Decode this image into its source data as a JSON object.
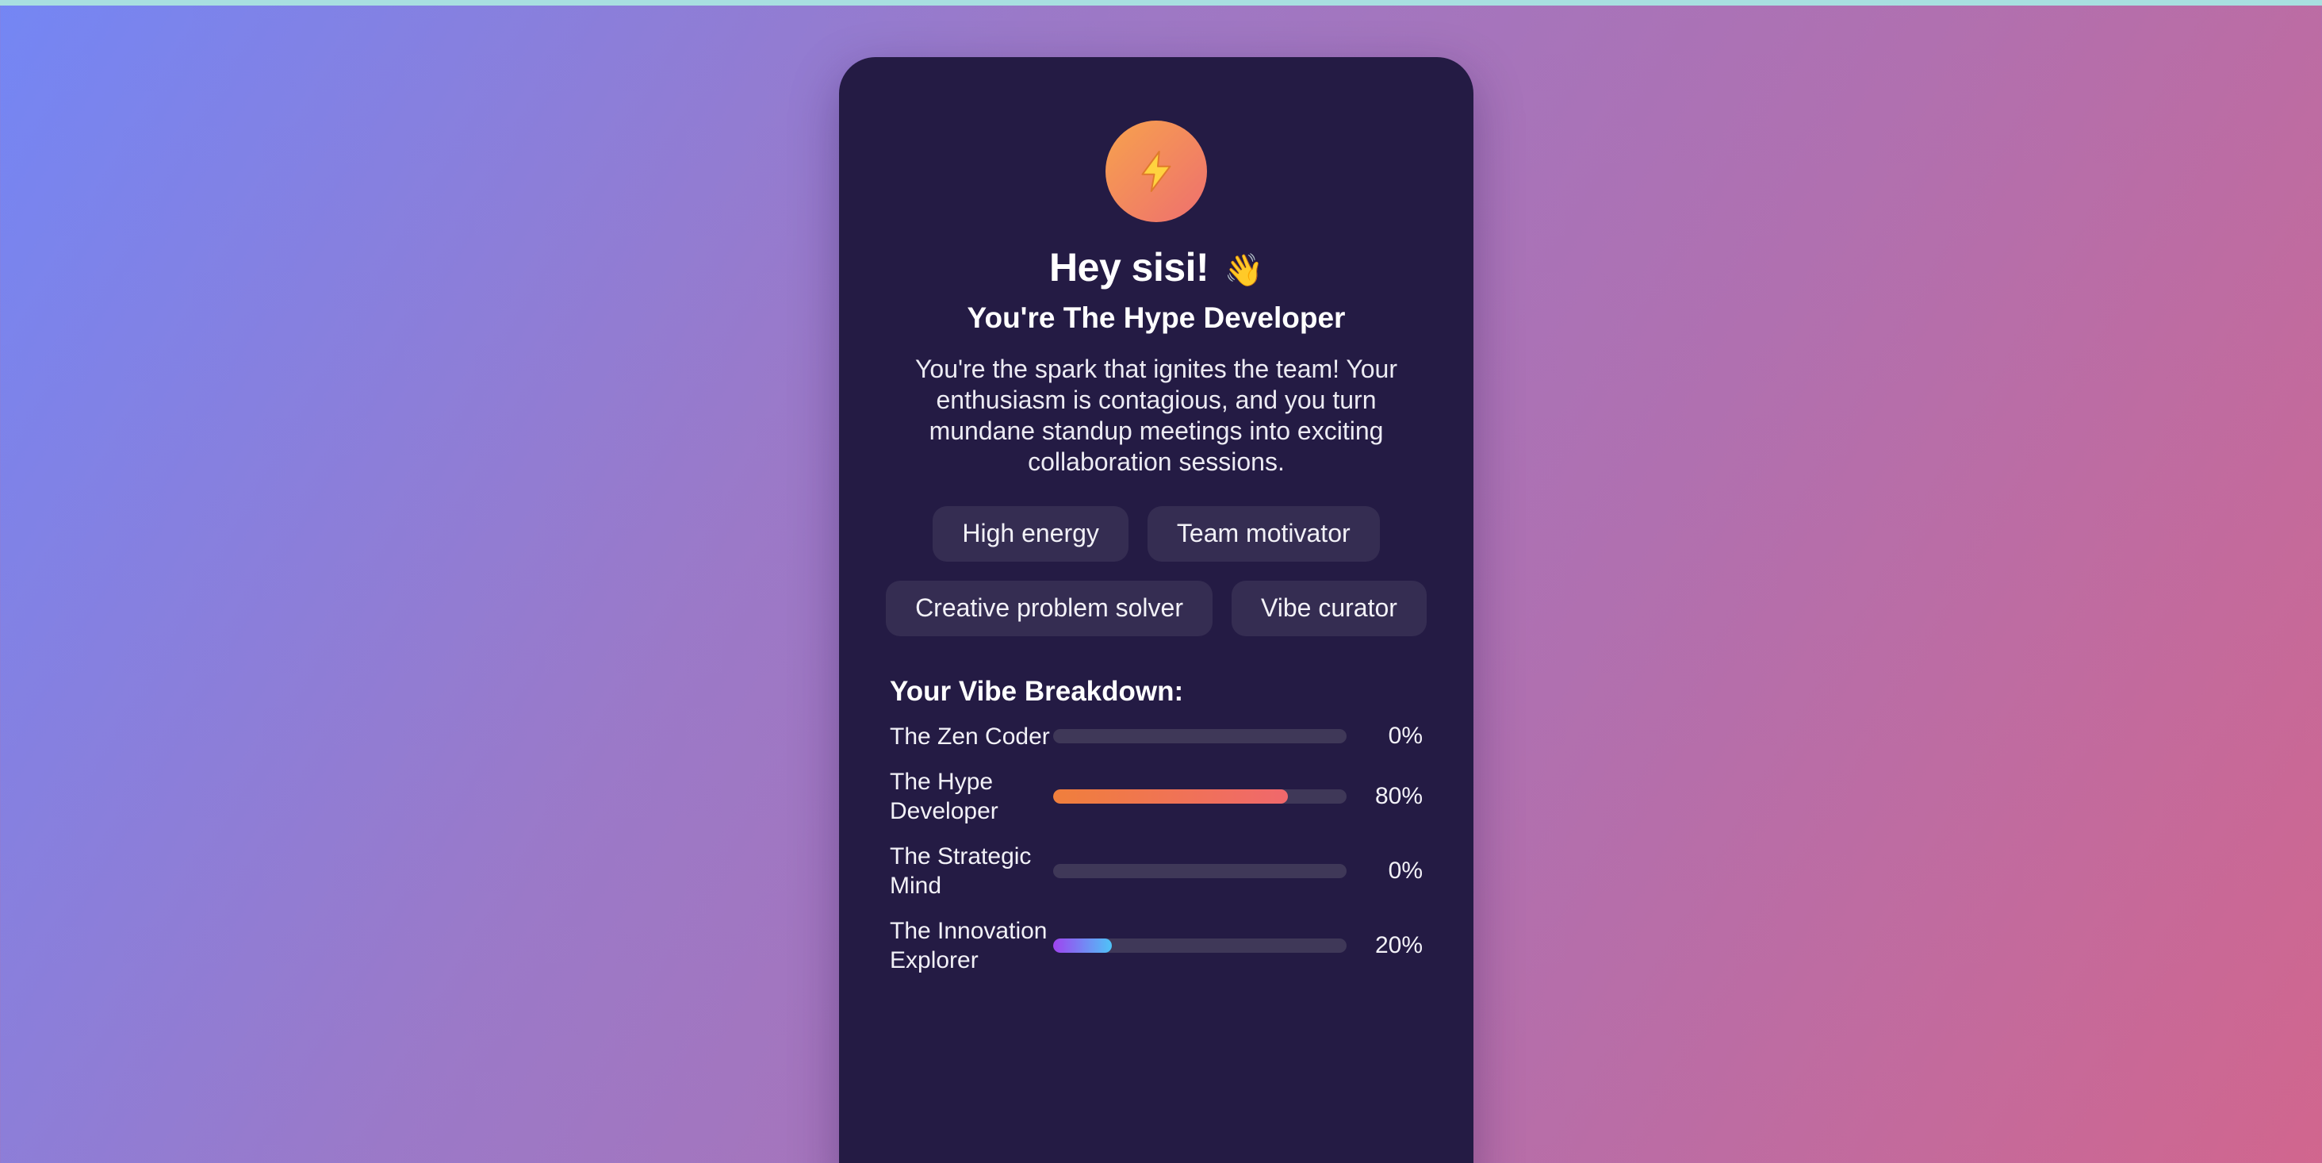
{
  "greeting": {
    "text": "Hey sisi!",
    "emoji": "👋"
  },
  "badge_icon": "lightning-bolt-icon",
  "result": {
    "title": "You're The Hype Developer",
    "description": "You're the spark that ignites the team! Your enthusiasm is contagious, and you turn mundane standup meetings into exciting collaboration sessions."
  },
  "traits": [
    {
      "label": "High energy"
    },
    {
      "label": "Team motivator"
    },
    {
      "label": "Creative problem solver"
    },
    {
      "label": "Vibe curator"
    }
  ],
  "breakdown": {
    "title": "Your Vibe Breakdown:",
    "items": [
      {
        "name": "The Zen Coder",
        "percent_label": "0%",
        "percent": 0,
        "colors": [
          "#a78bfa",
          "#8b5cf6"
        ]
      },
      {
        "name": "The Hype Developer",
        "percent_label": "80%",
        "percent": 80,
        "colors": [
          "#f07f3c",
          "#f0686c"
        ]
      },
      {
        "name": "The Strategic Mind",
        "percent_label": "0%",
        "percent": 0,
        "colors": [
          "#60a5fa",
          "#3b82f6"
        ]
      },
      {
        "name": "The Innovation Explorer",
        "percent_label": "20%",
        "percent": 20,
        "colors": [
          "#9f43f0",
          "#4fc3f7"
        ]
      }
    ]
  },
  "colors": {
    "background_start": "#7486f4",
    "background_end": "#d1668e",
    "card": "#241b44",
    "chip": "#352d52",
    "badge_start": "#f7a24d",
    "badge_end": "#ee6f6f"
  }
}
